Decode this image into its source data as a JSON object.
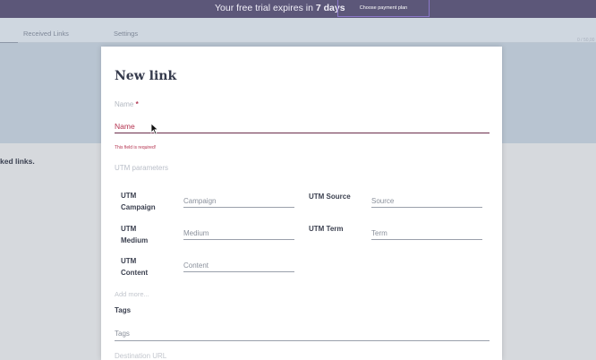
{
  "banner": {
    "message_prefix": "Your free trial expires in ",
    "message_bold": "7 days",
    "plan_button": "Choose payment plan"
  },
  "nav": {
    "items": [
      "Received Links",
      "Settings"
    ],
    "right_text": "0 / 50,00"
  },
  "background": {
    "snippet": "ked links."
  },
  "modal": {
    "title": "New link",
    "name_label": "Name",
    "required_mark": "*",
    "name_placeholder": "Name",
    "name_error": "This field is required!",
    "utm_heading": "UTM parameters",
    "utm_fields": [
      {
        "label_line1": "UTM",
        "label_line2": "Campaign",
        "placeholder": "Campaign"
      },
      {
        "label_line1": "UTM Source",
        "label_line2": "",
        "placeholder": "Source"
      },
      {
        "label_line1": "UTM",
        "label_line2": "Medium",
        "placeholder": "Medium"
      },
      {
        "label_line1": "UTM Term",
        "label_line2": "",
        "placeholder": "Term"
      },
      {
        "label_line1": "UTM",
        "label_line2": "Content",
        "placeholder": "Content"
      }
    ],
    "add_more": "Add more...",
    "tags_label": "Tags",
    "tags_placeholder": "Tags",
    "destination_label": "Destination URL"
  },
  "colors": {
    "banner_bg": "#5c5779",
    "error": "#b4324f",
    "plan_button_border": "#8b78c9"
  }
}
